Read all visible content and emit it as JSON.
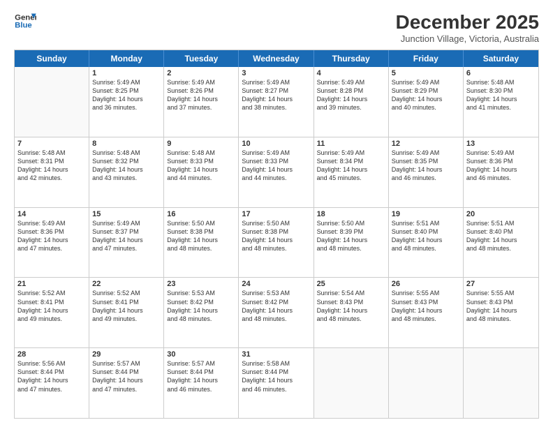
{
  "logo": {
    "line1": "General",
    "line2": "Blue"
  },
  "title": "December 2025",
  "location": "Junction Village, Victoria, Australia",
  "days": [
    "Sunday",
    "Monday",
    "Tuesday",
    "Wednesday",
    "Thursday",
    "Friday",
    "Saturday"
  ],
  "rows": [
    [
      {
        "num": "",
        "lines": []
      },
      {
        "num": "1",
        "lines": [
          "Sunrise: 5:49 AM",
          "Sunset: 8:25 PM",
          "Daylight: 14 hours",
          "and 36 minutes."
        ]
      },
      {
        "num": "2",
        "lines": [
          "Sunrise: 5:49 AM",
          "Sunset: 8:26 PM",
          "Daylight: 14 hours",
          "and 37 minutes."
        ]
      },
      {
        "num": "3",
        "lines": [
          "Sunrise: 5:49 AM",
          "Sunset: 8:27 PM",
          "Daylight: 14 hours",
          "and 38 minutes."
        ]
      },
      {
        "num": "4",
        "lines": [
          "Sunrise: 5:49 AM",
          "Sunset: 8:28 PM",
          "Daylight: 14 hours",
          "and 39 minutes."
        ]
      },
      {
        "num": "5",
        "lines": [
          "Sunrise: 5:49 AM",
          "Sunset: 8:29 PM",
          "Daylight: 14 hours",
          "and 40 minutes."
        ]
      },
      {
        "num": "6",
        "lines": [
          "Sunrise: 5:48 AM",
          "Sunset: 8:30 PM",
          "Daylight: 14 hours",
          "and 41 minutes."
        ]
      }
    ],
    [
      {
        "num": "7",
        "lines": [
          "Sunrise: 5:48 AM",
          "Sunset: 8:31 PM",
          "Daylight: 14 hours",
          "and 42 minutes."
        ]
      },
      {
        "num": "8",
        "lines": [
          "Sunrise: 5:48 AM",
          "Sunset: 8:32 PM",
          "Daylight: 14 hours",
          "and 43 minutes."
        ]
      },
      {
        "num": "9",
        "lines": [
          "Sunrise: 5:48 AM",
          "Sunset: 8:33 PM",
          "Daylight: 14 hours",
          "and 44 minutes."
        ]
      },
      {
        "num": "10",
        "lines": [
          "Sunrise: 5:49 AM",
          "Sunset: 8:33 PM",
          "Daylight: 14 hours",
          "and 44 minutes."
        ]
      },
      {
        "num": "11",
        "lines": [
          "Sunrise: 5:49 AM",
          "Sunset: 8:34 PM",
          "Daylight: 14 hours",
          "and 45 minutes."
        ]
      },
      {
        "num": "12",
        "lines": [
          "Sunrise: 5:49 AM",
          "Sunset: 8:35 PM",
          "Daylight: 14 hours",
          "and 46 minutes."
        ]
      },
      {
        "num": "13",
        "lines": [
          "Sunrise: 5:49 AM",
          "Sunset: 8:36 PM",
          "Daylight: 14 hours",
          "and 46 minutes."
        ]
      }
    ],
    [
      {
        "num": "14",
        "lines": [
          "Sunrise: 5:49 AM",
          "Sunset: 8:36 PM",
          "Daylight: 14 hours",
          "and 47 minutes."
        ]
      },
      {
        "num": "15",
        "lines": [
          "Sunrise: 5:49 AM",
          "Sunset: 8:37 PM",
          "Daylight: 14 hours",
          "and 47 minutes."
        ]
      },
      {
        "num": "16",
        "lines": [
          "Sunrise: 5:50 AM",
          "Sunset: 8:38 PM",
          "Daylight: 14 hours",
          "and 48 minutes."
        ]
      },
      {
        "num": "17",
        "lines": [
          "Sunrise: 5:50 AM",
          "Sunset: 8:38 PM",
          "Daylight: 14 hours",
          "and 48 minutes."
        ]
      },
      {
        "num": "18",
        "lines": [
          "Sunrise: 5:50 AM",
          "Sunset: 8:39 PM",
          "Daylight: 14 hours",
          "and 48 minutes."
        ]
      },
      {
        "num": "19",
        "lines": [
          "Sunrise: 5:51 AM",
          "Sunset: 8:40 PM",
          "Daylight: 14 hours",
          "and 48 minutes."
        ]
      },
      {
        "num": "20",
        "lines": [
          "Sunrise: 5:51 AM",
          "Sunset: 8:40 PM",
          "Daylight: 14 hours",
          "and 48 minutes."
        ]
      }
    ],
    [
      {
        "num": "21",
        "lines": [
          "Sunrise: 5:52 AM",
          "Sunset: 8:41 PM",
          "Daylight: 14 hours",
          "and 49 minutes."
        ]
      },
      {
        "num": "22",
        "lines": [
          "Sunrise: 5:52 AM",
          "Sunset: 8:41 PM",
          "Daylight: 14 hours",
          "and 49 minutes."
        ]
      },
      {
        "num": "23",
        "lines": [
          "Sunrise: 5:53 AM",
          "Sunset: 8:42 PM",
          "Daylight: 14 hours",
          "and 48 minutes."
        ]
      },
      {
        "num": "24",
        "lines": [
          "Sunrise: 5:53 AM",
          "Sunset: 8:42 PM",
          "Daylight: 14 hours",
          "and 48 minutes."
        ]
      },
      {
        "num": "25",
        "lines": [
          "Sunrise: 5:54 AM",
          "Sunset: 8:43 PM",
          "Daylight: 14 hours",
          "and 48 minutes."
        ]
      },
      {
        "num": "26",
        "lines": [
          "Sunrise: 5:55 AM",
          "Sunset: 8:43 PM",
          "Daylight: 14 hours",
          "and 48 minutes."
        ]
      },
      {
        "num": "27",
        "lines": [
          "Sunrise: 5:55 AM",
          "Sunset: 8:43 PM",
          "Daylight: 14 hours",
          "and 48 minutes."
        ]
      }
    ],
    [
      {
        "num": "28",
        "lines": [
          "Sunrise: 5:56 AM",
          "Sunset: 8:44 PM",
          "Daylight: 14 hours",
          "and 47 minutes."
        ]
      },
      {
        "num": "29",
        "lines": [
          "Sunrise: 5:57 AM",
          "Sunset: 8:44 PM",
          "Daylight: 14 hours",
          "and 47 minutes."
        ]
      },
      {
        "num": "30",
        "lines": [
          "Sunrise: 5:57 AM",
          "Sunset: 8:44 PM",
          "Daylight: 14 hours",
          "and 46 minutes."
        ]
      },
      {
        "num": "31",
        "lines": [
          "Sunrise: 5:58 AM",
          "Sunset: 8:44 PM",
          "Daylight: 14 hours",
          "and 46 minutes."
        ]
      },
      {
        "num": "",
        "lines": []
      },
      {
        "num": "",
        "lines": []
      },
      {
        "num": "",
        "lines": []
      }
    ]
  ]
}
